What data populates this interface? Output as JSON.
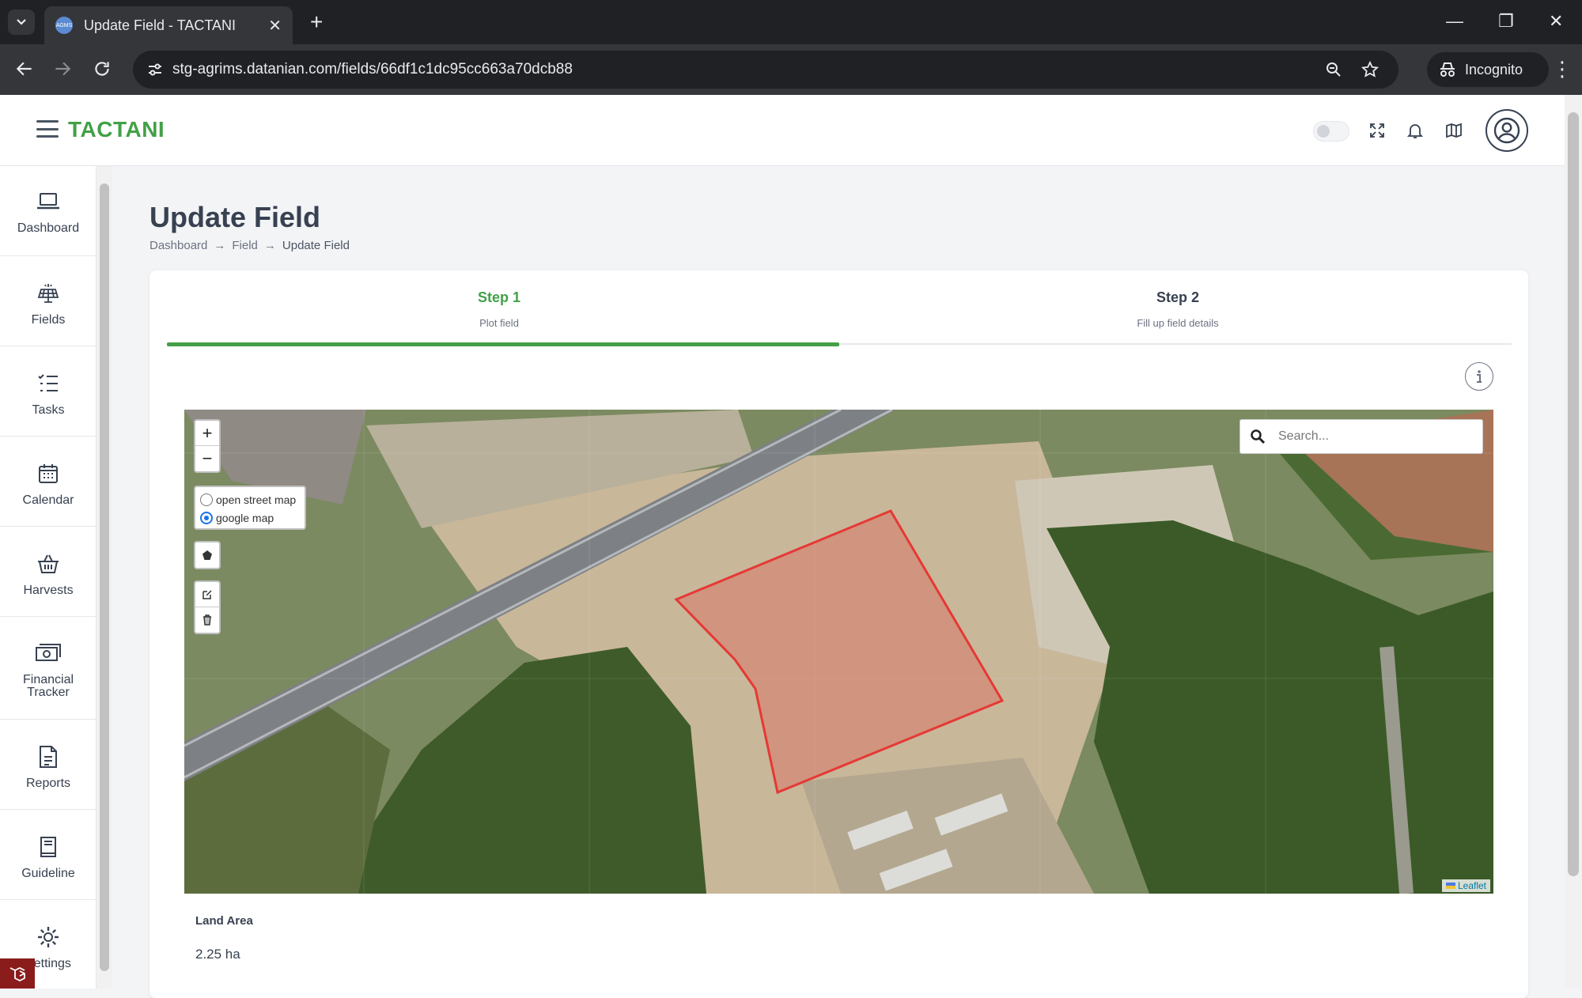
{
  "browser": {
    "tab_title": "Update Field - TACTANI",
    "favicon_text": "AGMS",
    "url": "stg-agrims.datanian.com/fields/66df1c1dc95cc663a70dcb88",
    "incognito_label": "Incognito"
  },
  "header": {
    "brand": "TACTANI"
  },
  "sidebar": {
    "items": [
      {
        "label": "Dashboard",
        "icon": "laptop-icon"
      },
      {
        "label": "Fields",
        "icon": "solar-panel-icon"
      },
      {
        "label": "Tasks",
        "icon": "checklist-icon"
      },
      {
        "label": "Calendar",
        "icon": "calendar-icon"
      },
      {
        "label": "Harvests",
        "icon": "basket-icon"
      },
      {
        "label": "Financial Tracker",
        "icon": "money-icon"
      },
      {
        "label": "Reports",
        "icon": "report-icon"
      },
      {
        "label": "Guideline",
        "icon": "book-icon"
      },
      {
        "label": "Settings",
        "icon": "gear-icon"
      }
    ]
  },
  "page": {
    "title": "Update Field",
    "breadcrumb": [
      "Dashboard",
      "Field",
      "Update Field"
    ]
  },
  "steps": [
    {
      "title": "Step 1",
      "subtitle": "Plot field",
      "active": true
    },
    {
      "title": "Step 2",
      "subtitle": "Fill up field details",
      "active": false
    }
  ],
  "progress": 0.5,
  "map": {
    "zoom_in": "+",
    "zoom_out": "−",
    "layer_options": [
      {
        "label": "open street map",
        "selected": false
      },
      {
        "label": "google map",
        "selected": true
      }
    ],
    "search_placeholder": "Search...",
    "attribution": "Leaflet",
    "polygon_color": "#e53935"
  },
  "land_area": {
    "label": "Land Area",
    "value": "2.25 ha"
  },
  "colors": {
    "brand": "#43a047",
    "accent": "#1a73e8"
  }
}
